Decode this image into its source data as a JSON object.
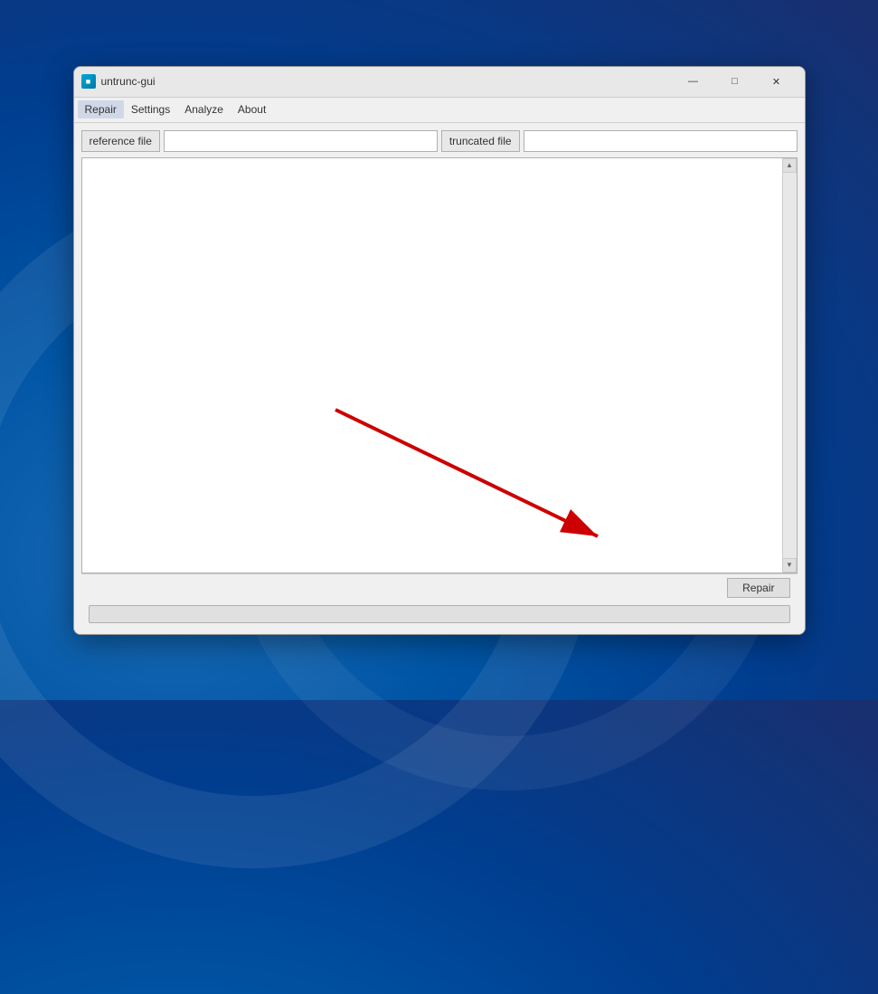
{
  "window": {
    "title": "untrunc-gui",
    "icon_label": "U"
  },
  "title_controls": {
    "minimize": "—",
    "maximize": "□",
    "close": "✕"
  },
  "menu": {
    "items": [
      {
        "id": "repair",
        "label": "Repair",
        "active": true
      },
      {
        "id": "settings",
        "label": "Settings",
        "active": false
      },
      {
        "id": "analyze",
        "label": "Analyze",
        "active": false
      },
      {
        "id": "about",
        "label": "About",
        "active": false
      }
    ]
  },
  "fields": {
    "reference_file_label": "reference file",
    "reference_file_value": "",
    "truncated_file_label": "truncated file",
    "truncated_file_value": ""
  },
  "buttons": {
    "repair_label": "Repair"
  },
  "progress": {
    "value": 0
  }
}
